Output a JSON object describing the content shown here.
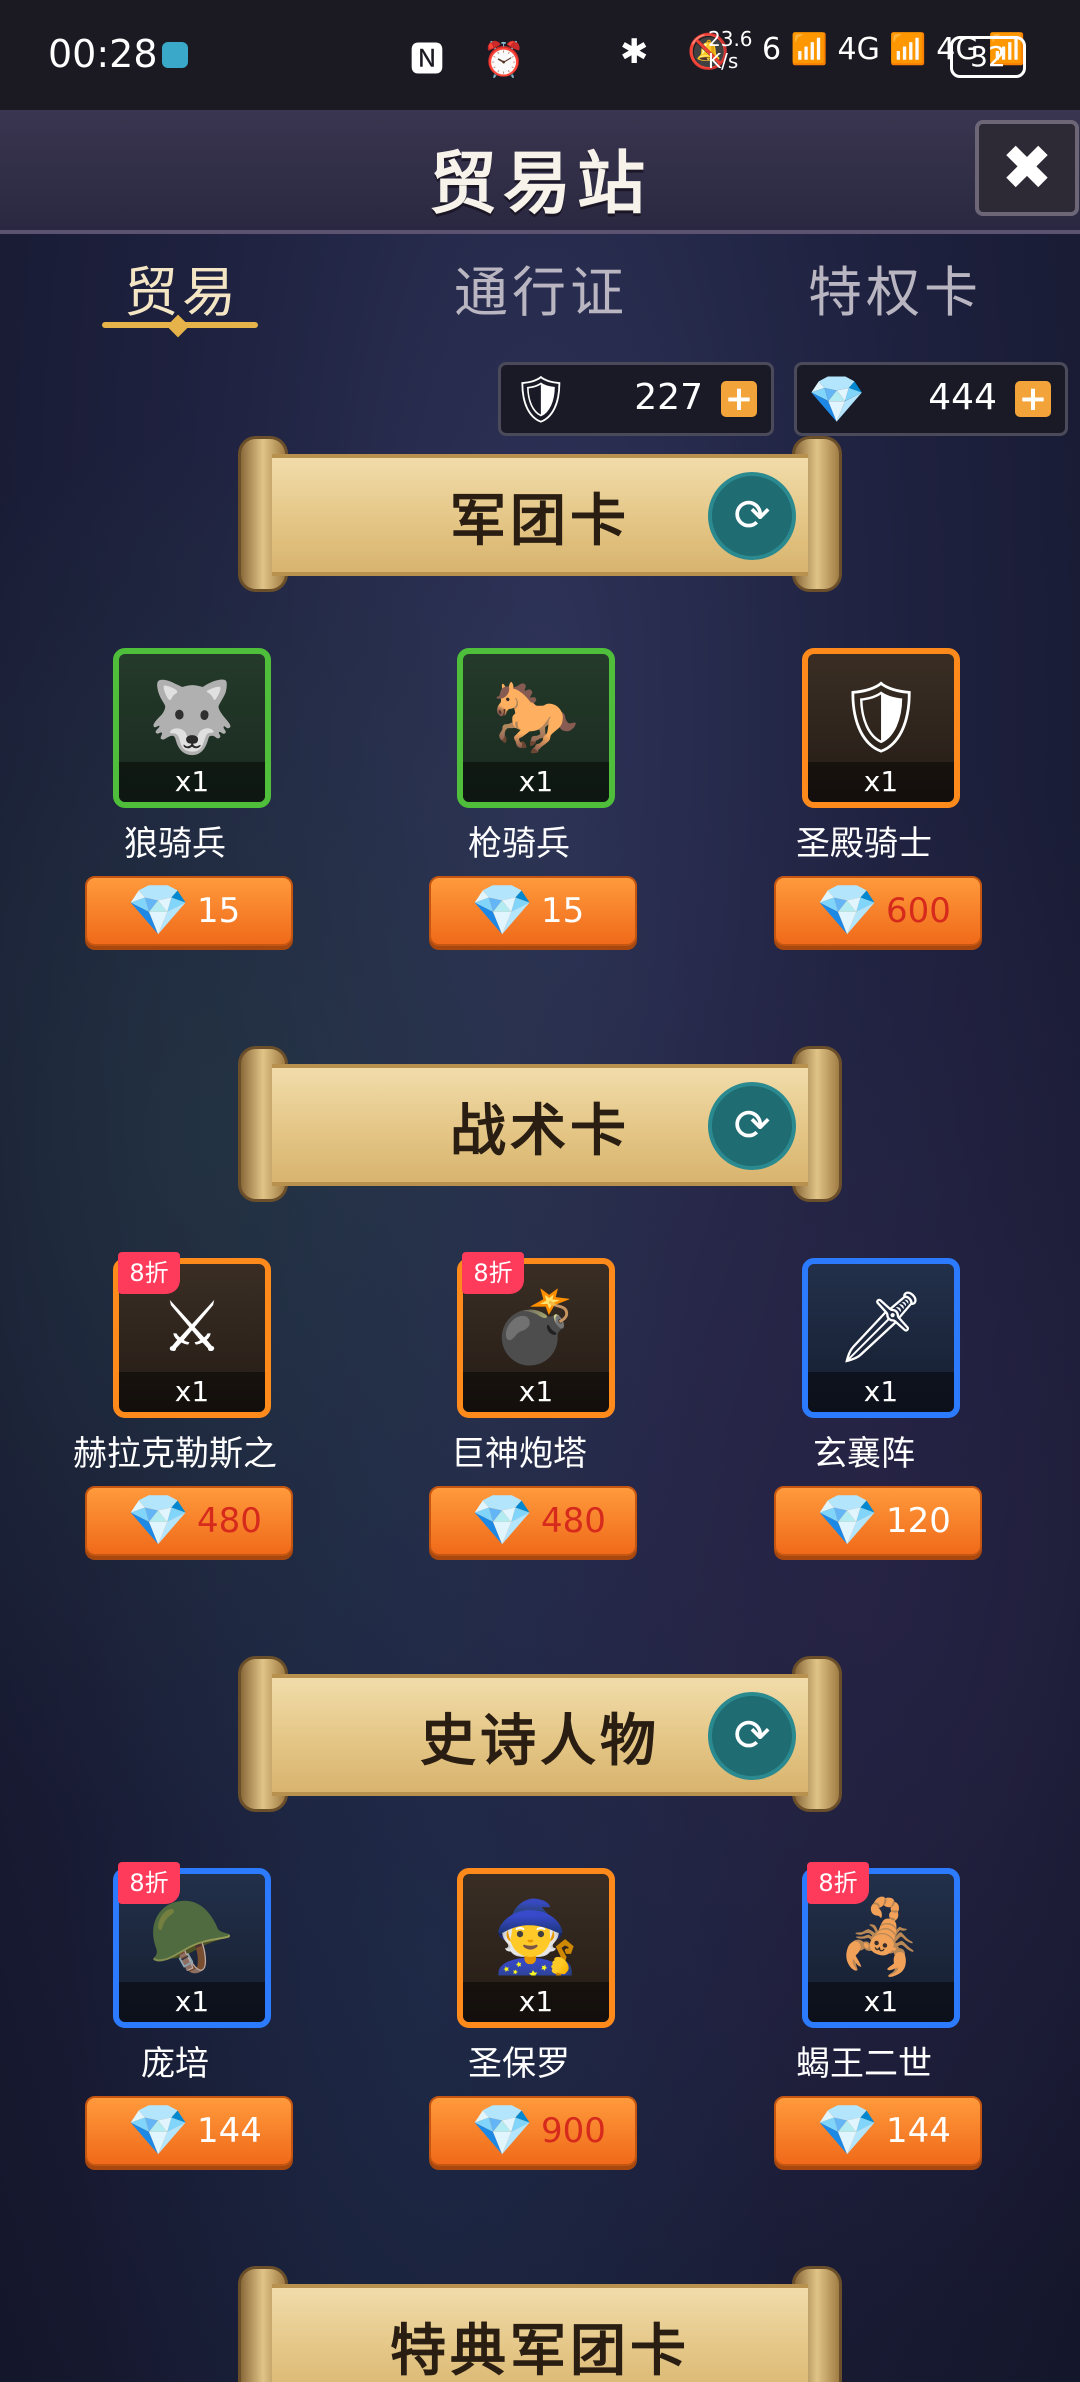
{
  "status_bar": {
    "time": "00:28",
    "icons": "🅽 ⏰",
    "right_icons": "✱ 🔕",
    "net_speed": "23.6\nK/s",
    "network": "6 📶 4G 📶 4G 📶",
    "battery": "32"
  },
  "header": {
    "title": "贸易站",
    "close_label": "✖"
  },
  "tabs": [
    {
      "label": "贸易",
      "active": true
    },
    {
      "label": "通行证",
      "active": false
    },
    {
      "label": "特权卡",
      "active": false
    }
  ],
  "currency": [
    {
      "icon": "🛡",
      "value": "227",
      "plus": "+"
    },
    {
      "icon": "💎",
      "value": "444",
      "plus": "+"
    }
  ],
  "sections": [
    {
      "title": "军团卡",
      "refresh_icon": "⟳",
      "items": [
        {
          "name": "狼骑兵",
          "qty": "x1",
          "price": "15",
          "rarity": "green",
          "badge": "",
          "portrait": "🐺"
        },
        {
          "name": "枪骑兵",
          "qty": "x1",
          "price": "15",
          "rarity": "green",
          "badge": "",
          "portrait": "🐎"
        },
        {
          "name": "圣殿骑士",
          "qty": "x1",
          "price": "600",
          "rarity": "orange",
          "badge": "",
          "portrait": "🛡"
        }
      ]
    },
    {
      "title": "战术卡",
      "refresh_icon": "⟳",
      "items": [
        {
          "name": "赫拉克勒斯之",
          "qty": "x1",
          "price": "480",
          "rarity": "orange",
          "badge": "8折",
          "portrait": "⚔"
        },
        {
          "name": "巨神炮塔",
          "qty": "x1",
          "price": "480",
          "rarity": "orange",
          "badge": "8折",
          "portrait": "💣"
        },
        {
          "name": "玄襄阵",
          "qty": "x1",
          "price": "120",
          "rarity": "blue",
          "badge": "",
          "portrait": "🗡"
        }
      ]
    },
    {
      "title": "史诗人物",
      "refresh_icon": "⟳",
      "items": [
        {
          "name": "庞培",
          "qty": "x1",
          "price": "144",
          "rarity": "blue",
          "badge": "8折",
          "portrait": "🪖"
        },
        {
          "name": "圣保罗",
          "qty": "x1",
          "price": "900",
          "rarity": "orange",
          "badge": "",
          "portrait": "🧙"
        },
        {
          "name": "蝎王二世",
          "qty": "x1",
          "price": "144",
          "rarity": "blue",
          "badge": "8折",
          "portrait": "🦂"
        }
      ]
    },
    {
      "title": "特典军团卡",
      "refresh_icon": "",
      "items": []
    }
  ],
  "price_gem_icon": "💎",
  "colors": {
    "accent_gold": "#e5b34a",
    "price_orange": "#f06a1a",
    "badge_pink": "#ff3b5c",
    "red_price": "#d62a1c"
  }
}
